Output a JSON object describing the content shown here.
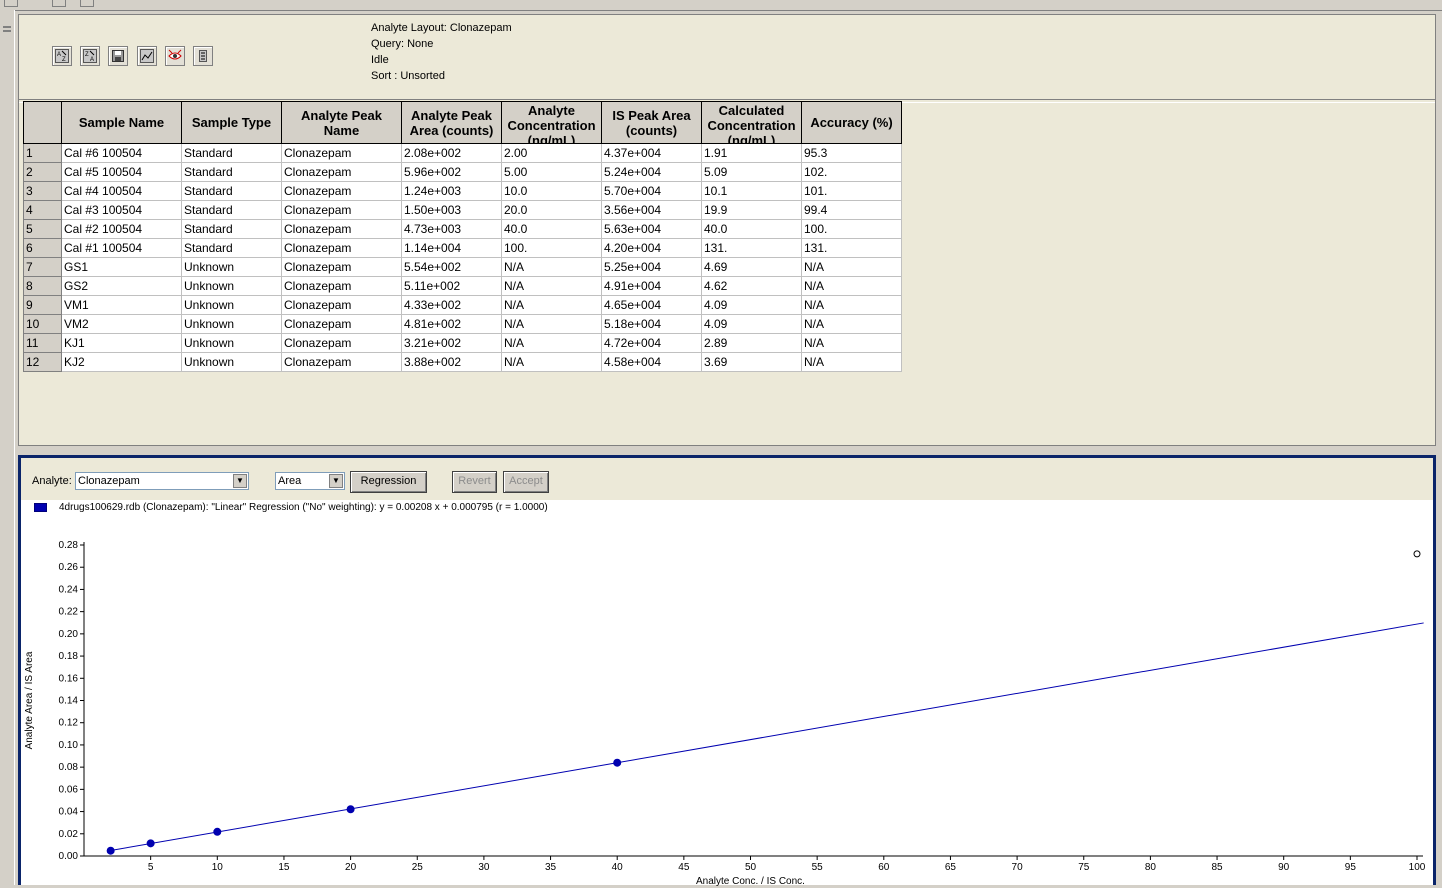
{
  "toolbar": {
    "icons": [
      "sort-ascending-icon",
      "sort-descending-icon",
      "save-icon",
      "chart-icon",
      "peak-review-icon",
      "filter-icon"
    ]
  },
  "status": {
    "analyte_layout": "Analyte Layout:  Clonazepam",
    "query": "Query: None",
    "state": "Idle",
    "sort": "Sort : Unsorted"
  },
  "table": {
    "columns": [
      "Sample Name",
      "Sample Type",
      "Analyte Peak Name",
      "Analyte Peak Area (counts)",
      "Analyte Concentration (ng/mL)",
      "IS Peak Area (counts)",
      "Calculated Concentration (ng/mL)",
      "Accuracy (%)"
    ],
    "rows": [
      [
        "1",
        "Cal #6 100504",
        "Standard",
        "Clonazepam",
        "2.08e+002",
        "2.00",
        "4.37e+004",
        "1.91",
        "95.3"
      ],
      [
        "2",
        "Cal #5 100504",
        "Standard",
        "Clonazepam",
        "5.96e+002",
        "5.00",
        "5.24e+004",
        "5.09",
        "102."
      ],
      [
        "3",
        "Cal #4 100504",
        "Standard",
        "Clonazepam",
        "1.24e+003",
        "10.0",
        "5.70e+004",
        "10.1",
        "101."
      ],
      [
        "4",
        "Cal #3 100504",
        "Standard",
        "Clonazepam",
        "1.50e+003",
        "20.0",
        "3.56e+004",
        "19.9",
        "99.4"
      ],
      [
        "5",
        "Cal #2 100504",
        "Standard",
        "Clonazepam",
        "4.73e+003",
        "40.0",
        "5.63e+004",
        "40.0",
        "100."
      ],
      [
        "6",
        "Cal #1 100504",
        "Standard",
        "Clonazepam",
        "1.14e+004",
        "100.",
        "4.20e+004",
        "131.",
        "131."
      ],
      [
        "7",
        "GS1",
        "Unknown",
        "Clonazepam",
        "5.54e+002",
        "N/A",
        "5.25e+004",
        "4.69",
        "N/A"
      ],
      [
        "8",
        "GS2",
        "Unknown",
        "Clonazepam",
        "5.11e+002",
        "N/A",
        "4.91e+004",
        "4.62",
        "N/A"
      ],
      [
        "9",
        "VM1",
        "Unknown",
        "Clonazepam",
        "4.33e+002",
        "N/A",
        "4.65e+004",
        "4.09",
        "N/A"
      ],
      [
        "10",
        "VM2",
        "Unknown",
        "Clonazepam",
        "4.81e+002",
        "N/A",
        "5.18e+004",
        "4.09",
        "N/A"
      ],
      [
        "11",
        "KJ1",
        "Unknown",
        "Clonazepam",
        "3.21e+002",
        "N/A",
        "4.72e+004",
        "2.89",
        "N/A"
      ],
      [
        "12",
        "KJ2",
        "Unknown",
        "Clonazepam",
        "3.88e+002",
        "N/A",
        "4.58e+004",
        "3.69",
        "N/A"
      ]
    ]
  },
  "controls": {
    "analyte_label": "Analyte:",
    "analyte_value": "Clonazepam",
    "mode_value": "Area",
    "regression_label": "Regression",
    "revert_label": "Revert",
    "accept_label": "Accept"
  },
  "colors": {
    "series": "#0000b0",
    "selection_border": "#0a246a"
  },
  "chart_data": {
    "type": "scatter",
    "legend": "4drugs100629.rdb (Clonazepam): \"Linear\" Regression (\"No\" weighting): y = 0.00208 x + 0.000795 (r = 1.0000)",
    "xlabel": "Analyte Conc. / IS Conc.",
    "ylabel": "Analyte Area / IS Area",
    "xlim": [
      0,
      100
    ],
    "ylim": [
      0,
      0.28
    ],
    "xticks": [
      5,
      10,
      15,
      20,
      25,
      30,
      35,
      40,
      45,
      50,
      55,
      60,
      65,
      70,
      75,
      80,
      85,
      90,
      95,
      100
    ],
    "yticks": [
      "0.00",
      "0.02",
      "0.04",
      "0.06",
      "0.08",
      "0.10",
      "0.12",
      "0.14",
      "0.16",
      "0.18",
      "0.20",
      "0.22",
      "0.24",
      "0.26",
      "0.28"
    ],
    "series": [
      {
        "values": [
          {
            "x": 2,
            "y": 0.00476,
            "filled": true
          },
          {
            "x": 5,
            "y": 0.0114,
            "filled": true
          },
          {
            "x": 10,
            "y": 0.0218,
            "filled": true
          },
          {
            "x": 20,
            "y": 0.0421,
            "filled": true
          },
          {
            "x": 40,
            "y": 0.084,
            "filled": true
          },
          {
            "x": 100,
            "y": 0.272,
            "filled": false
          }
        ]
      }
    ],
    "fit_line": {
      "slope": 0.00208,
      "intercept": 0.000795
    }
  }
}
